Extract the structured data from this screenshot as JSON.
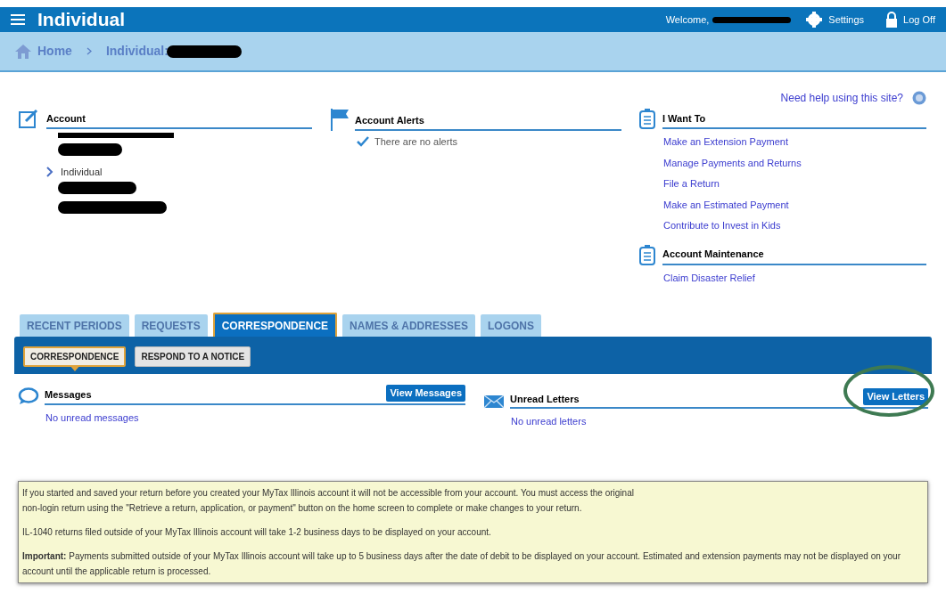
{
  "header": {
    "title": "Individual",
    "welcome": "Welcome,",
    "settings": "Settings",
    "logoff": "Log Off"
  },
  "breadcrumb": [
    {
      "label": "Home"
    },
    {
      "label": "Individual:"
    }
  ],
  "help_link": "Need help using this site?",
  "account": {
    "heading": "Account",
    "item": "Individual"
  },
  "alerts": {
    "heading": "Account Alerts",
    "message": "There are no alerts"
  },
  "i_want_to": {
    "heading": "I Want To",
    "links": [
      "Make an Extension Payment",
      "Manage Payments and Returns",
      "File a Return",
      "Make an Estimated Payment",
      "Contribute to Invest in Kids"
    ]
  },
  "maintenance": {
    "heading": "Account Maintenance",
    "links": [
      "Claim Disaster Relief"
    ]
  },
  "tabs": [
    {
      "label": "RECENT PERIODS",
      "selected": false
    },
    {
      "label": "REQUESTS",
      "selected": false
    },
    {
      "label": "CORRESPONDENCE",
      "selected": true
    },
    {
      "label": "NAMES & ADDRESSES",
      "selected": false
    },
    {
      "label": "LOGONS",
      "selected": false
    }
  ],
  "subtabs": [
    {
      "label": "CORRESPONDENCE",
      "selected": true
    },
    {
      "label": "RESPOND TO A NOTICE",
      "selected": false
    }
  ],
  "messages": {
    "heading": "Messages",
    "button": "View Messages",
    "empty": "No unread messages"
  },
  "letters": {
    "heading": "Unread Letters",
    "button": "View Letters",
    "empty": "No unread letters",
    "highlighted": true
  },
  "notice": [
    "If you started and saved your return before you created your MyTax Illinois account it will not be accessible from your account. You must access the original\nnon-login return using the \"Retrieve a return, application, or payment\" button on the home screen to complete or make changes to your return.",
    "IL-1040 returns filed outside of your MyTax Illinois account will take 1-2 business days to be displayed on your account.",
    "**Important:** Payments submitted outside of your MyTax Illinois account will take up to 5 business days after the date of debit to be displayed on your account. Estimated and extension payments may not be displayed on your account until the applicable return is processed."
  ]
}
